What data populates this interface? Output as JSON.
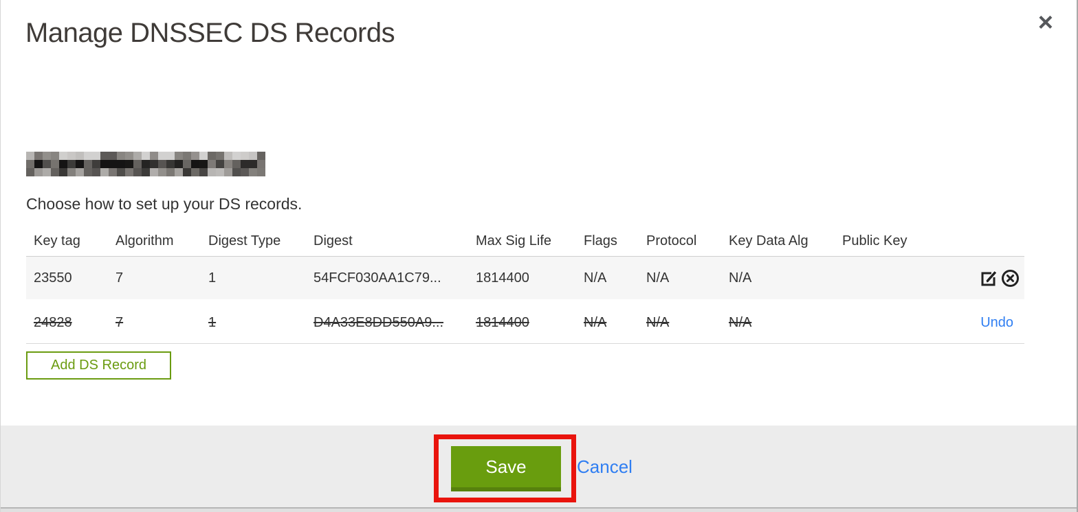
{
  "dialog": {
    "title": "Manage DNSSEC DS Records",
    "close_label": "×",
    "subtitle": "Choose how to set up your DS records."
  },
  "table": {
    "headers": [
      "Key tag",
      "Algorithm",
      "Digest Type",
      "Digest",
      "Max Sig Life",
      "Flags",
      "Protocol",
      "Key Data Alg",
      "Public Key"
    ],
    "rows": [
      {
        "key_tag": "23550",
        "algorithm": "7",
        "digest_type": "1",
        "digest": "54FCF030AA1C79...",
        "max_sig_life": "1814400",
        "flags": "N/A",
        "protocol": "N/A",
        "key_data_alg": "N/A",
        "public_key": "",
        "state": "normal"
      },
      {
        "key_tag": "24828",
        "algorithm": "7",
        "digest_type": "1",
        "digest": "D4A33E8DD550A9...",
        "max_sig_life": "1814400",
        "flags": "N/A",
        "protocol": "N/A",
        "key_data_alg": "N/A",
        "public_key": "",
        "state": "deleted",
        "undo_label": "Undo"
      }
    ]
  },
  "buttons": {
    "add_ds_record": "Add DS Record",
    "save": "Save",
    "cancel": "Cancel"
  },
  "colors": {
    "green": "#6a9b10",
    "green_button": "#699d0e",
    "green_button_shadow": "#57810d",
    "link_blue": "#2f7ef2",
    "annotation_red": "#e9140d",
    "row_stripe": "#f6f6f6",
    "footer_grey": "#ececec"
  }
}
